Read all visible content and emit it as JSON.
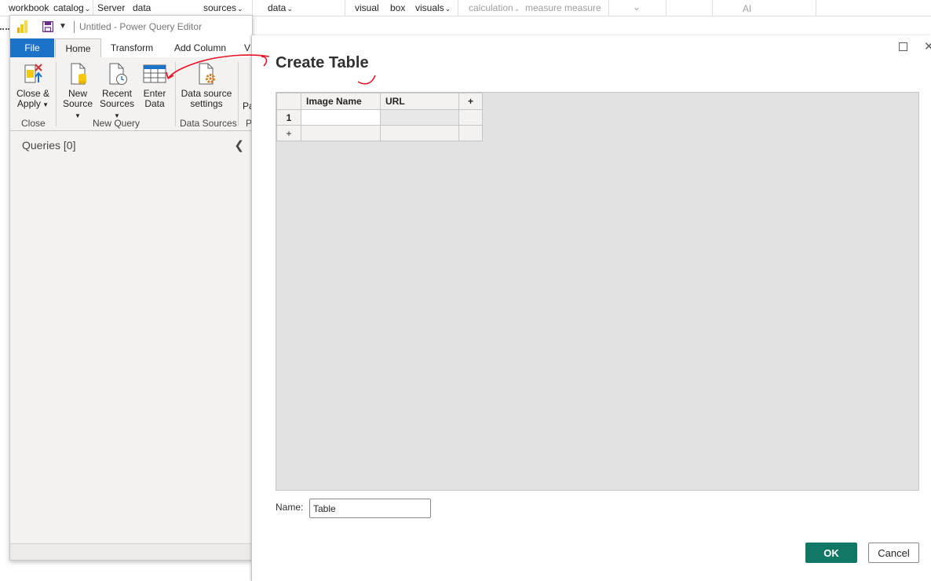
{
  "background_ribbon": {
    "items": [
      {
        "label": "workbook",
        "dim": false
      },
      {
        "label": "catalog",
        "dim": false
      },
      {
        "label": "Server",
        "dim": false
      },
      {
        "label": "data",
        "dim": false
      },
      {
        "label": "sources",
        "dim": false
      },
      {
        "label": "data",
        "dim": false
      },
      {
        "label": "visual",
        "dim": false
      },
      {
        "label": "box",
        "dim": false
      },
      {
        "label": "visuals",
        "dim": false
      },
      {
        "label": "calculation",
        "dim": true
      },
      {
        "label": "measure",
        "dim": true
      },
      {
        "label": "measure",
        "dim": true
      },
      {
        "label": "AI",
        "dim": true
      }
    ]
  },
  "pq_window": {
    "title": "Untitled - Power Query Editor",
    "tabs": {
      "file": "File",
      "home": "Home",
      "transform": "Transform",
      "add_column": "Add Column",
      "view": "V"
    },
    "ribbon": {
      "close_apply": {
        "line1": "Close &",
        "line2": "Apply"
      },
      "new_source": {
        "line1": "New",
        "line2": "Source"
      },
      "recent_sources": {
        "line1": "Recent",
        "line2": "Sources"
      },
      "enter_data": {
        "line1": "Enter",
        "line2": "Data"
      },
      "data_source_settings": {
        "line1": "Data source",
        "line2": "settings"
      },
      "partial": "Pa",
      "groups": {
        "close": "Close",
        "new_query": "New Query",
        "data_sources": "Data Sources",
        "partial": "P"
      }
    },
    "queries_label": "Queries [0]"
  },
  "dialog": {
    "title": "Create Table",
    "table": {
      "columns": [
        "Image Name",
        "URL"
      ],
      "add_column_label": "+",
      "rows": [
        {
          "number": "1",
          "cells": [
            "",
            ""
          ]
        }
      ],
      "add_row_label": "+"
    },
    "name_label": "Name:",
    "name_value": "Table",
    "ok_label": "OK",
    "cancel_label": "Cancel"
  },
  "colors": {
    "accent_file_tab": "#1a73c8",
    "ok_button": "#117865",
    "annotation": "#e81123",
    "powerbi_yellow": "#f2c811"
  }
}
